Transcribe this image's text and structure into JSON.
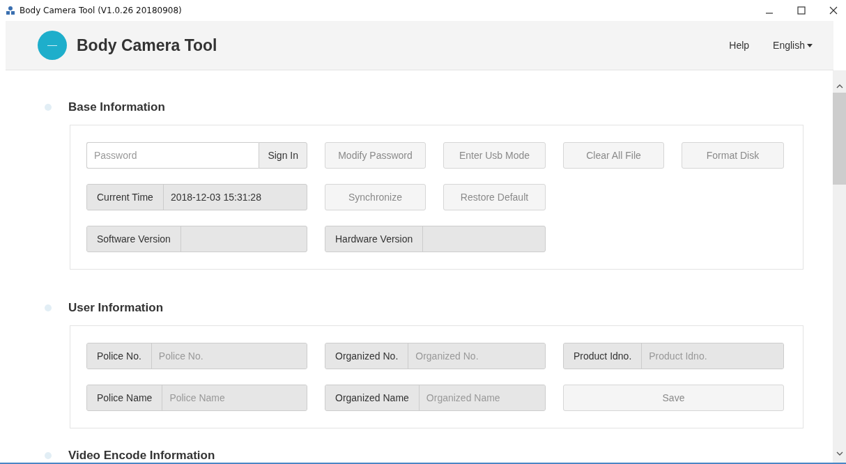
{
  "window": {
    "title": "Body Camera Tool  (V1.0.26 20180908)"
  },
  "header": {
    "app_name": "Body Camera Tool",
    "help": "Help",
    "language": "English"
  },
  "base_information": {
    "title": "Base Information",
    "password": {
      "placeholder": "Password"
    },
    "sign_in": {
      "label": "Sign In",
      "disabled": false
    },
    "row1_buttons": [
      {
        "label": "Modify Password",
        "disabled": true
      },
      {
        "label": "Enter Usb Mode",
        "disabled": true
      },
      {
        "label": "Clear All File",
        "disabled": true
      },
      {
        "label": "Format Disk",
        "disabled": true
      }
    ],
    "current_time": {
      "label": "Current Time",
      "value": "2018-12-03 15:31:28"
    },
    "row2_buttons": [
      {
        "label": "Synchronize",
        "disabled": true
      },
      {
        "label": "Restore Default",
        "disabled": true
      }
    ],
    "software_version": {
      "label": "Software Version"
    },
    "hardware_version": {
      "label": "Hardware Version"
    }
  },
  "user_information": {
    "title": "User Information",
    "fields": [
      {
        "label": "Police No.",
        "placeholder": "Police No."
      },
      {
        "label": "Organized No.",
        "placeholder": "Organized No."
      },
      {
        "label": "Product Idno.",
        "placeholder": "Product Idno."
      },
      {
        "label": "Police Name",
        "placeholder": "Police Name"
      },
      {
        "label": "Organized Name",
        "placeholder": "Organized Name"
      }
    ],
    "save": {
      "label": "Save",
      "disabled": true
    }
  },
  "next_section": {
    "title": "Video Encode Information"
  }
}
